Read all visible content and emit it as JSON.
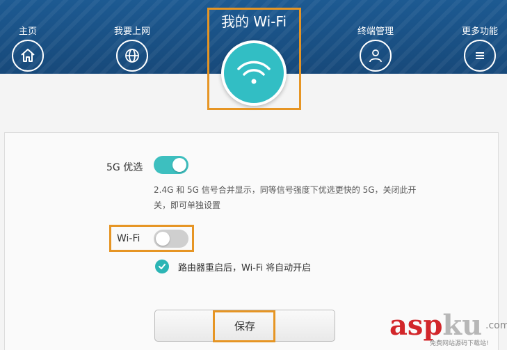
{
  "nav": {
    "items": [
      {
        "label": "主页",
        "icon": "home-icon"
      },
      {
        "label": "我要上网",
        "icon": "globe-icon"
      },
      {
        "label": "终端管理",
        "icon": "user-icon"
      },
      {
        "label": "更多功能",
        "icon": "menu-icon"
      }
    ],
    "active": {
      "label": "我的 Wi-Fi",
      "icon": "wifi-icon"
    }
  },
  "settings": {
    "band5g": {
      "label": "5G 优选",
      "enabled": true
    },
    "band5g_desc": "2.4G 和 5G 信号合并显示，同等信号强度下优选更快的 5G，关闭此开关，即可单独设置",
    "wifi": {
      "label": "Wi-Fi",
      "enabled": false
    },
    "auto_on": {
      "checked": true,
      "label": "路由器重启后，Wi-Fi 将自动开启"
    }
  },
  "save_label": "保存",
  "watermark": {
    "brand_a": "asp",
    "brand_b": "ku",
    "suffix": ".com",
    "tagline": "免费网站源码下载站!"
  },
  "colors": {
    "header": "#1b5489",
    "accent": "#32bec4",
    "highlight": "#e69524",
    "watermark_red": "#d2262a"
  }
}
